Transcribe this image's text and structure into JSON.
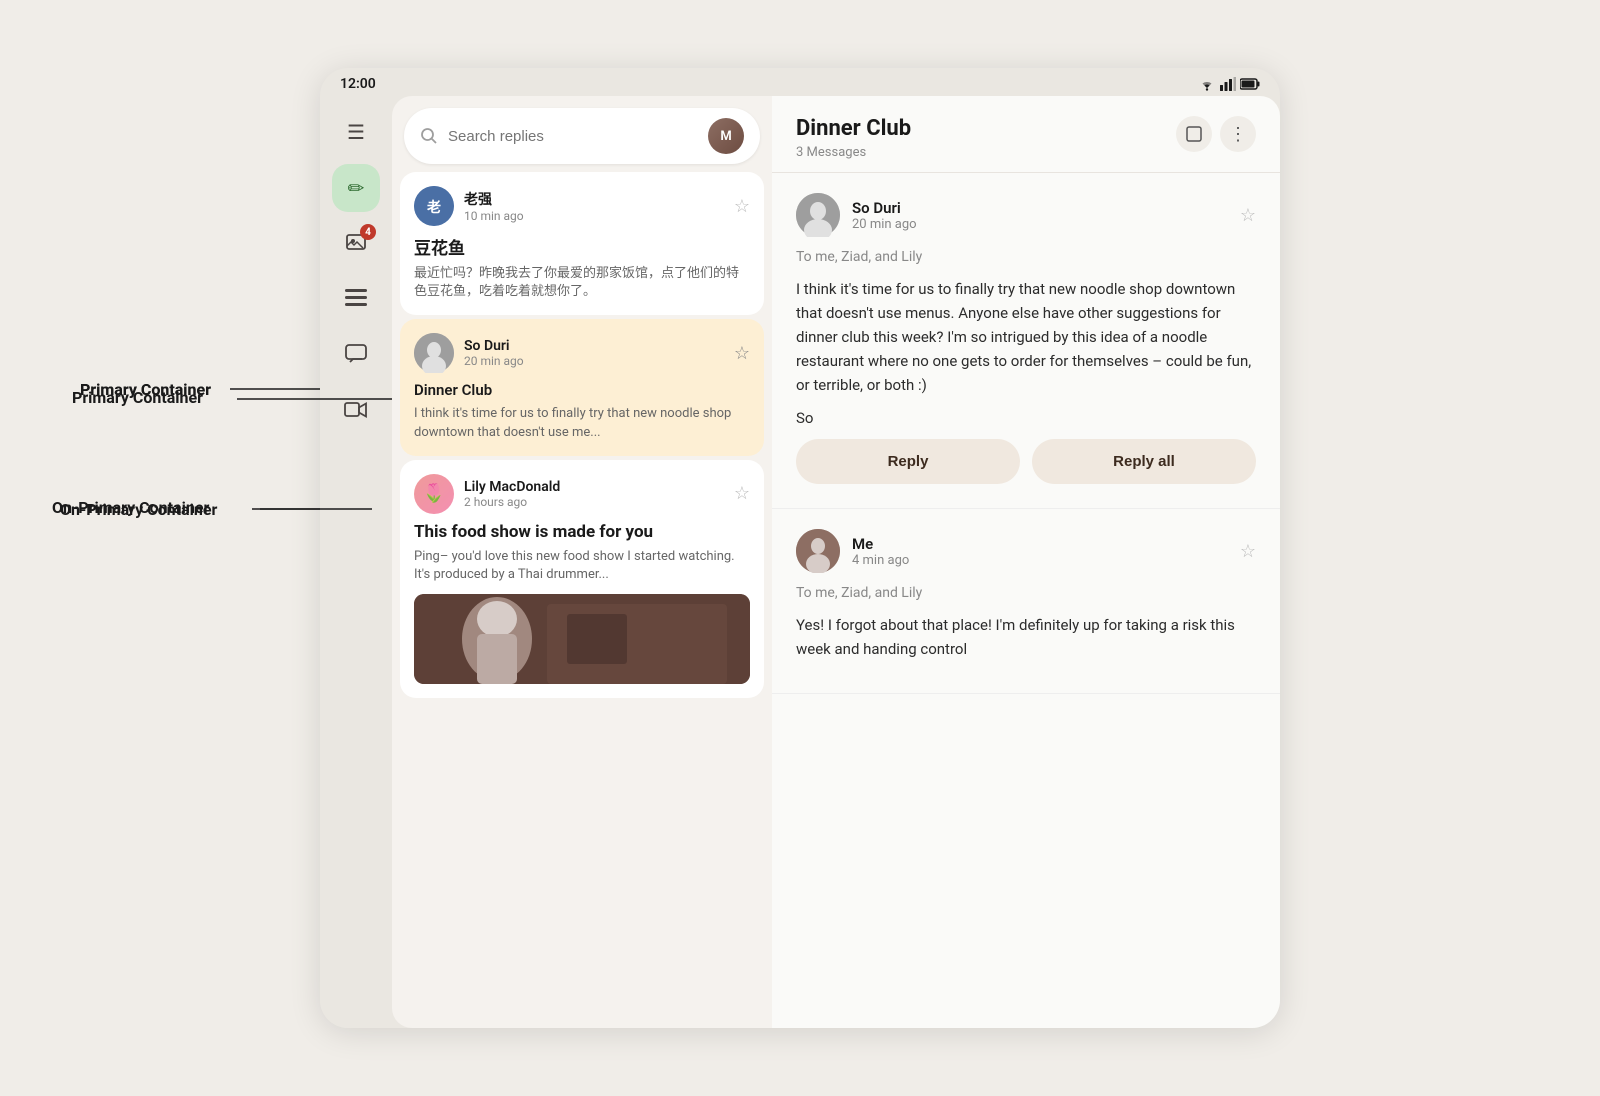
{
  "statusBar": {
    "time": "12:00",
    "icons": [
      "wifi",
      "signal",
      "battery"
    ]
  },
  "sidebar": {
    "icons": [
      {
        "name": "menu",
        "symbol": "☰",
        "label": "menu-icon"
      },
      {
        "name": "compose",
        "symbol": "✏",
        "label": "compose-icon",
        "style": "compose"
      },
      {
        "name": "photo",
        "symbol": "🖼",
        "label": "photo-icon",
        "badge": "4"
      },
      {
        "name": "list",
        "symbol": "≡",
        "label": "list-icon"
      },
      {
        "name": "chat",
        "symbol": "☐",
        "label": "chat-icon"
      },
      {
        "name": "video",
        "symbol": "□",
        "label": "video-icon"
      }
    ]
  },
  "searchBar": {
    "placeholder": "Search replies"
  },
  "emailList": {
    "items": [
      {
        "sender": "老强",
        "time": "10 min ago",
        "subject": "豆花鱼",
        "preview": "最近忙吗？昨晚我去了你最爱的那家饭馆，点了他们的特色豆花鱼，吃着吃着就想你了。",
        "selected": false,
        "avatarStyle": "laozi"
      },
      {
        "sender": "So Duri",
        "time": "20 min ago",
        "subject": "Dinner Club",
        "preview": "I think it's time for us to finally try that new noodle shop downtown that doesn't use me...",
        "selected": true,
        "avatarStyle": "soduri"
      },
      {
        "sender": "Lily MacDonald",
        "time": "2 hours ago",
        "subject": "This food show is made for you",
        "preview": "Ping– you'd love this new food show I started watching. It's produced by a Thai drummer...",
        "selected": false,
        "hasImage": true,
        "avatarStyle": "lily"
      }
    ]
  },
  "emailDetail": {
    "subject": "Dinner Club",
    "messageCount": "3 Messages",
    "messages": [
      {
        "sender": "So Duri",
        "time": "20 min ago",
        "to": "To me, Ziad, and Lily",
        "body": "I think it's time for us to finally try that new noodle shop downtown that doesn't use menus. Anyone else have other suggestions for dinner club this week? I'm so intrigued by this idea of a noodle restaurant where no one gets to order for themselves – could be fun, or terrible, or both :)",
        "signature": "So",
        "avatarStyle": "soduri-large",
        "showReply": true
      },
      {
        "sender": "Me",
        "time": "4 min ago",
        "to": "To me, Ziad, and Lily",
        "body": "Yes! I forgot about that place! I'm definitely up for taking a risk this week and handing control",
        "avatarStyle": "me",
        "showReply": false
      }
    ],
    "replyButton": "Reply",
    "replyAllButton": "Reply all"
  },
  "annotations": {
    "primaryContainer": "Primary Container",
    "onPrimaryContainer": "On-Primary Container"
  }
}
